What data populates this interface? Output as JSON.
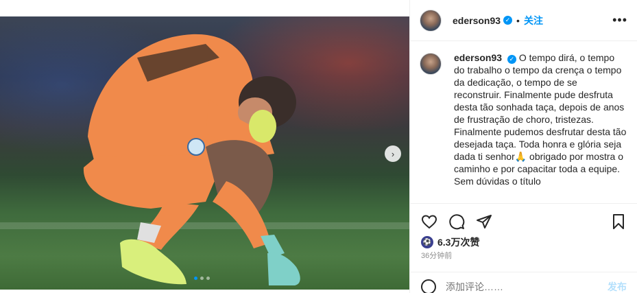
{
  "post": {
    "image_alt": "",
    "carousel": {
      "total": 3,
      "active_index": 0
    }
  },
  "header": {
    "username": "ederson93",
    "separator": "•",
    "follow_label": "关注",
    "more_label": "•••",
    "verified_icon": "verified-badge-icon"
  },
  "caption": {
    "username": "ederson93",
    "text": "O tempo dirá, o tempo do trabalho o tempo da crença o tempo da dedicação, o tempo de se reconstruir. Finalmente pude desfruta desta tão sonhada taça, depois de anos de frustração de choro, tristezas. Finalmente pudemos desfrutar desta tão desejada taça. Toda honra e glória seja dada ti senhor🙏 obrigado por mostra o caminho e por capacitar toda a equipe. Sem dúvidas o título"
  },
  "actions": {
    "icons": [
      "heart-icon",
      "comment-icon",
      "share-icon",
      "bookmark-icon"
    ]
  },
  "likes": {
    "count_label": "6.3万次赞"
  },
  "timestamp": "36分钟前",
  "comment": {
    "placeholder": "添加评论……",
    "post_label": "发布"
  },
  "colors": {
    "accent": "#0095f6",
    "jersey": "#f08a4b",
    "pitch": "#3e6a36"
  }
}
